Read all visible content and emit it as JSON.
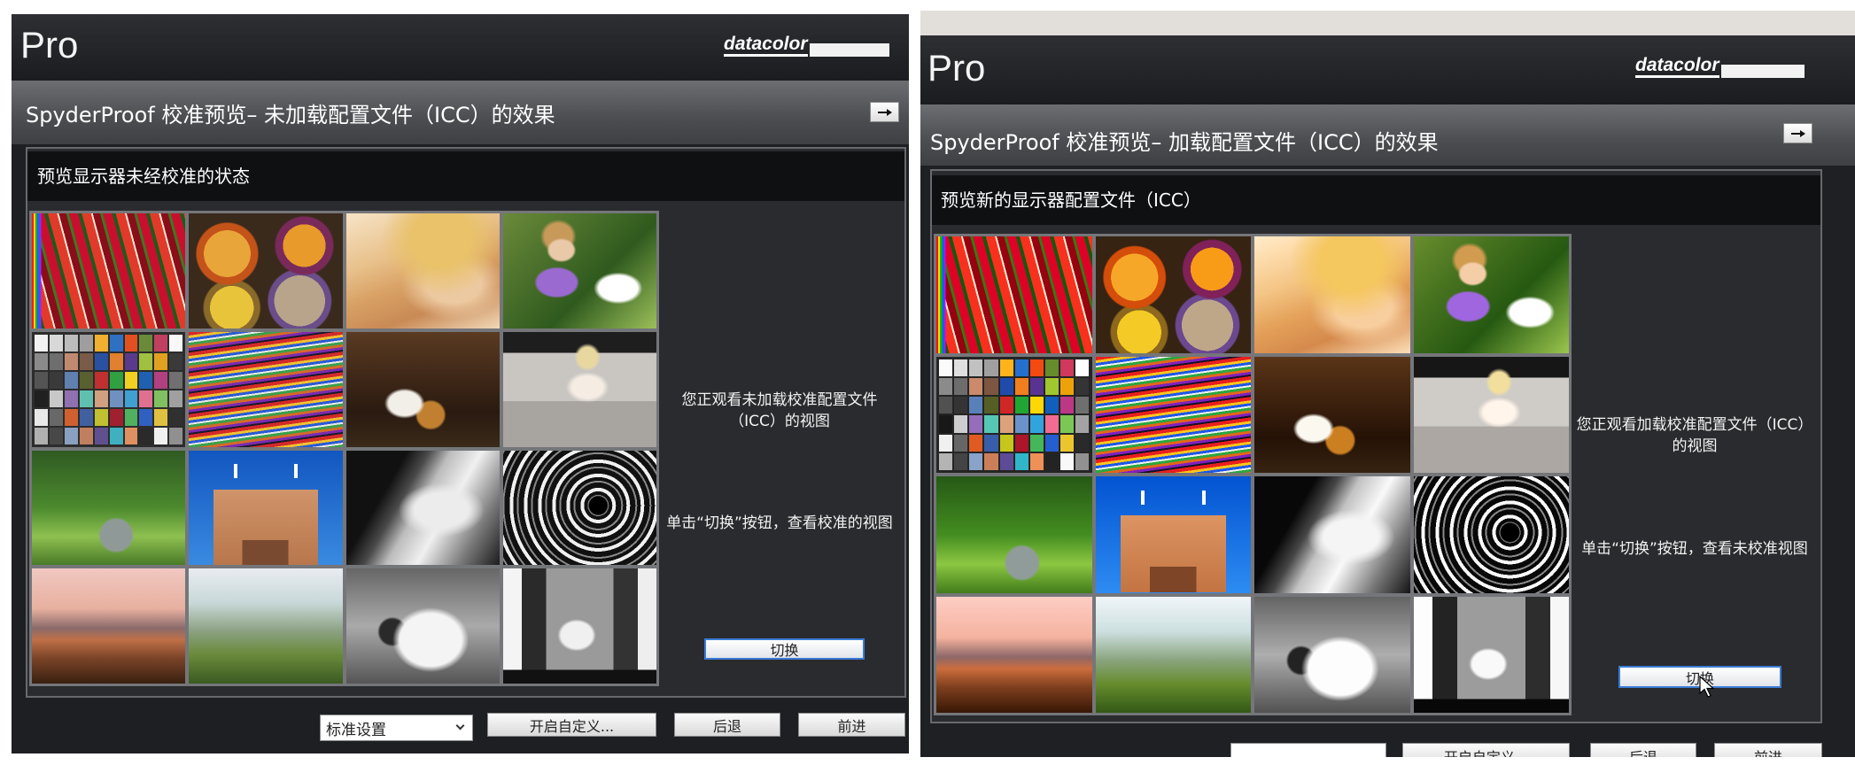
{
  "left": {
    "app_name": "Pro",
    "logo_text": "datacolor",
    "title": "SpyderProof 校准预览– 未加载配置文件（ICC）的效果",
    "collapse_icon": "arrow-right-icon",
    "subtitle": "预览显示器未经校准的状态",
    "status_message": "您正观看未加载校准配置文件（ICC）的视图",
    "instruction": "单击“切换”按钮，查看校准的视图",
    "toggle_label": "切换",
    "footer": {
      "preset_select_value": "标准设置",
      "custom_label": "开启自定义...",
      "back_label": "后退",
      "next_label": "前进"
    }
  },
  "right": {
    "app_name": "Pro",
    "logo_text": "datacolor",
    "title": "SpyderProof 校准预览– 加载配置文件（ICC）的效果",
    "collapse_icon": "arrow-right-icon",
    "subtitle": "预览新的显示器配置文件（ICC）",
    "status_message": "您正观看加载校准配置文件（ICC）的视图",
    "instruction": "单击“切换”按钮，查看未校准视图",
    "toggle_label": "切换",
    "cursor_icon": "mouse-pointer-icon",
    "footer": {
      "custom_label": "开启自定义...",
      "back_label": "后退",
      "next_label": "前进"
    }
  },
  "colors": {
    "focus_border": "#3b7bd6",
    "panel_background": "#2a2b2e",
    "subheader_background": "#0f1012"
  }
}
